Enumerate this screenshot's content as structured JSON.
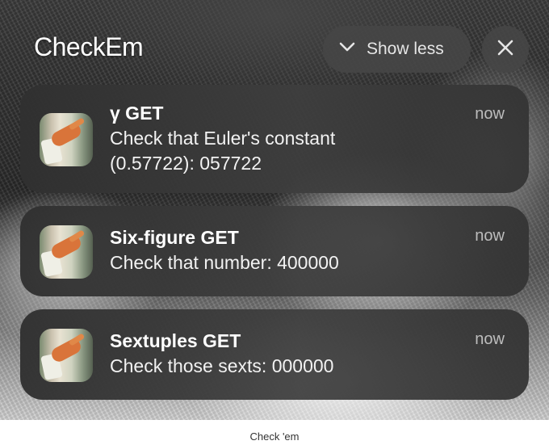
{
  "header": {
    "app_title": "CheckEm",
    "show_less_label": "Show less"
  },
  "icons": {
    "show_less": "chevron-down-icon",
    "close": "close-icon"
  },
  "notifications": [
    {
      "title": "γ GET",
      "body": "Check that Euler's constant (0.57722): 057722",
      "time": "now"
    },
    {
      "title": "Six-figure GET",
      "body": "Check that number: 400000",
      "time": "now"
    },
    {
      "title": "Sextuples GET",
      "body": "Check those sexts: 000000",
      "time": "now"
    }
  ],
  "caption": "Check 'em",
  "colors": {
    "notification_bg": "#3a3a3a",
    "title_text": "#ffffff",
    "time_text": "#bdbdbd"
  }
}
